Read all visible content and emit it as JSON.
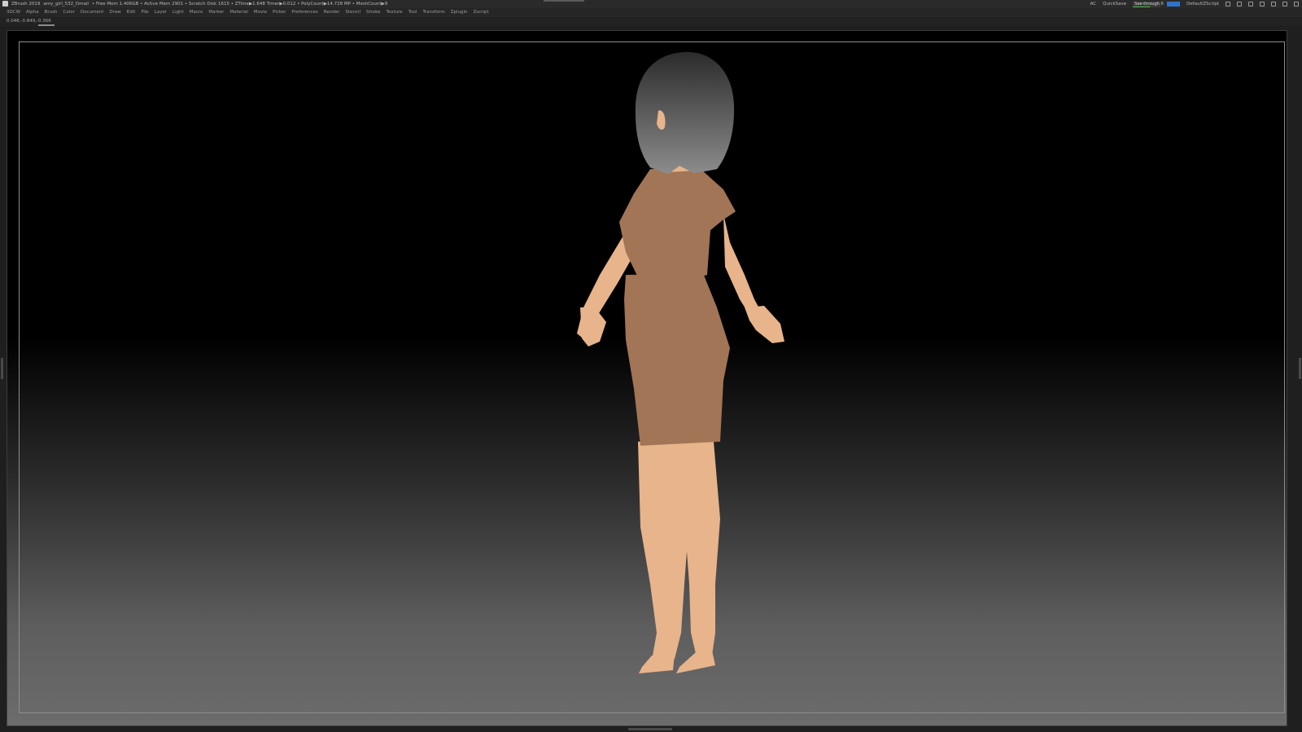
{
  "titlebar": {
    "app": "ZBrush 2019",
    "file": "amy_girl_532_Dmail",
    "stats": "• Free Mem 1.406GB • Active Mem 2901 • Scratch Disk 1615 • ZTime▶1.648 Timer▶0.012 • PolyCount▶14.728 MP • MeshCount▶9",
    "ac": "AC",
    "quicksave": "QuickSave",
    "seethrough_label": "See-through",
    "seethrough_value": "0",
    "script": "DefaultZScript"
  },
  "menu": [
    "3DCW",
    "Alpha",
    "Brush",
    "Color",
    "Document",
    "Draw",
    "Edit",
    "File",
    "Layer",
    "Light",
    "Macro",
    "Marker",
    "Material",
    "Movie",
    "Picker",
    "Preferences",
    "Render",
    "Stencil",
    "Stroke",
    "Texture",
    "Tool",
    "Transform",
    "Zplugin",
    "Zscript"
  ],
  "coords": "0.046,-0.849,-0.366",
  "colors": {
    "skin": "#e7b48b",
    "dress": "#a27556",
    "hair_top": "#2b2b2b",
    "hair_bottom": "#8c8c8c",
    "accent_blue": "#2f74c8",
    "accent_green": "#3bbf4a"
  }
}
